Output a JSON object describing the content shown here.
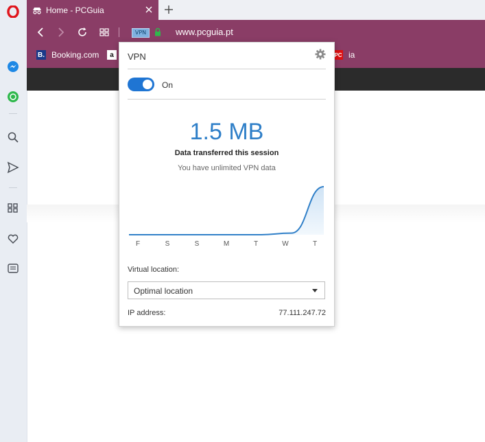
{
  "browser": {
    "tab": {
      "title": "Home - PCGuia"
    },
    "address": {
      "url": "www.pcguia.pt",
      "vpn_badge": "VPN"
    },
    "bookmarks": [
      {
        "label": "Booking.com",
        "icon": "B."
      },
      {
        "label": "",
        "icon": "a"
      },
      {
        "label": "ia",
        "icon": "PC"
      }
    ]
  },
  "vpn_popup": {
    "title": "VPN",
    "toggle_label": "On",
    "toggle_on": true,
    "data_amount": "1.5 MB",
    "data_caption": "Data transferred this session",
    "data_note": "You have unlimited VPN data",
    "virtual_location_label": "Virtual location:",
    "location_value": "Optimal location",
    "ip_label": "IP address:",
    "ip_value": "77.111.247.72"
  },
  "chart_data": {
    "type": "area",
    "categories": [
      "F",
      "S",
      "S",
      "M",
      "T",
      "W",
      "T"
    ],
    "values": [
      0,
      0,
      0,
      0,
      0,
      0.05,
      1.5
    ],
    "ylim": [
      0,
      1.5
    ],
    "grid": false
  },
  "colors": {
    "accent": "#8a3d66",
    "vpn_blue": "#2f7fc8",
    "toggle": "#1f75d3"
  }
}
